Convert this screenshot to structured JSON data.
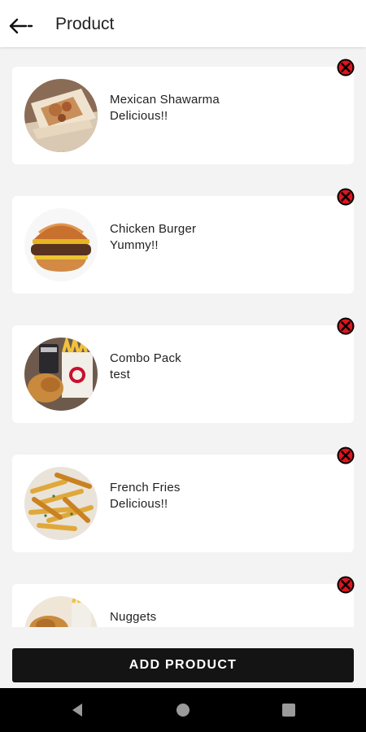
{
  "header": {
    "back_icon": "arrow-left-icon",
    "title": "Product"
  },
  "products": [
    {
      "name": "Mexican Shawarma",
      "description": "Delicious!!",
      "image": "shawarma-image"
    },
    {
      "name": "Chicken Burger",
      "description": "Yummy!!",
      "image": "burger-image"
    },
    {
      "name": "Combo Pack",
      "description": "test",
      "image": "combo-pack-image"
    },
    {
      "name": "French Fries",
      "description": "Delicious!!",
      "image": "fries-image"
    },
    {
      "name": "Nuggets",
      "description": "",
      "image": "nuggets-image"
    }
  ],
  "remove_icon": "close-circle-icon",
  "footer": {
    "add_button_label": "ADD PRODUCT"
  },
  "system_nav": {
    "back": "triangle-back-icon",
    "home": "circle-home-icon",
    "recents": "square-recents-icon"
  },
  "colors": {
    "accent": "#141414",
    "remove_icon_fill": "#e0141e",
    "page_background": "#f3f3f3"
  }
}
